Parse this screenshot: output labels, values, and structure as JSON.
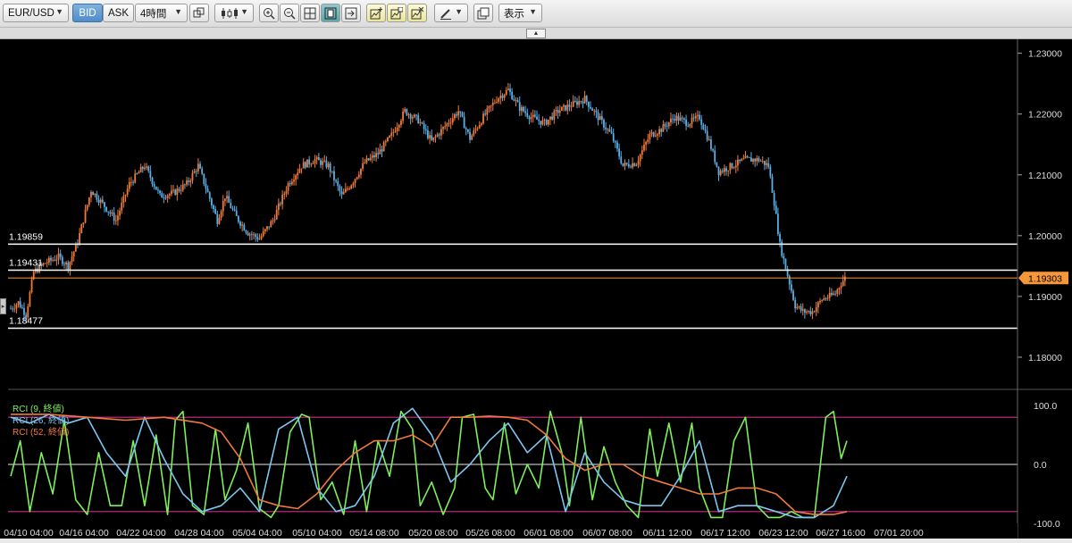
{
  "toolbar": {
    "symbol": "EUR/USD",
    "bid_label": "BID",
    "ask_label": "ASK",
    "timeframe": "4時間",
    "view_label": "表示",
    "caret": "▼"
  },
  "colors": {
    "background": "#000000",
    "bull_candle": "#f07a3a",
    "bear_candle": "#5aaee6",
    "price_line": "#f5973a",
    "horizontal_line": "#ffffff",
    "rci9": "#7df05a",
    "rci26": "#7cc6f0",
    "rci52": "#f07a3a",
    "rci_band": "#c8308c"
  },
  "chart_data": [
    {
      "type": "candlestick",
      "instrument": "EUR/USD",
      "timeframe": "4時間",
      "ylim": [
        1.175,
        1.232
      ],
      "y_ticks": [
        "1.23000",
        "1.22000",
        "1.21000",
        "1.20000",
        "1.19000",
        "1.18000"
      ],
      "x_ticks": [
        "04/10 04:00",
        "04/16 04:00",
        "04/22 04:00",
        "04/28 04:00",
        "05/04 04:00",
        "05/10 04:00",
        "05/14 08:00",
        "05/20 08:00",
        "05/26 08:00",
        "06/01 08:00",
        "06/07 08:00",
        "06/11 12:00",
        "06/17 12:00",
        "06/23 12:00",
        "06/27 16:00",
        "07/01 20:00"
      ],
      "current_price": "1.19303",
      "horizontal_lines": [
        {
          "label": "1.19859",
          "value": 1.19859
        },
        {
          "label": "1.19431",
          "value": 1.19431
        },
        {
          "label": "1.18477",
          "value": 1.18477
        }
      ],
      "price_path": [
        [
          0,
          1.188
        ],
        [
          4,
          1.189
        ],
        [
          8,
          1.187
        ],
        [
          12,
          1.194
        ],
        [
          18,
          1.1955
        ],
        [
          25,
          1.1965
        ],
        [
          30,
          1.195
        ],
        [
          35,
          1.199
        ],
        [
          42,
          1.2075
        ],
        [
          50,
          1.2045
        ],
        [
          55,
          1.2025
        ],
        [
          62,
          1.2085
        ],
        [
          70,
          1.2115
        ],
        [
          78,
          1.2065
        ],
        [
          85,
          1.207
        ],
        [
          92,
          1.2085
        ],
        [
          98,
          1.2115
        ],
        [
          103,
          1.207
        ],
        [
          108,
          1.2025
        ],
        [
          112,
          1.2065
        ],
        [
          118,
          1.203
        ],
        [
          124,
          1.2005
        ],
        [
          130,
          1.1995
        ],
        [
          137,
          1.2025
        ],
        [
          145,
          1.2085
        ],
        [
          152,
          1.2115
        ],
        [
          159,
          1.2125
        ],
        [
          166,
          1.2115
        ],
        [
          173,
          1.2065
        ],
        [
          179,
          1.209
        ],
        [
          185,
          1.212
        ],
        [
          192,
          1.2135
        ],
        [
          199,
          1.2165
        ],
        [
          206,
          1.2205
        ],
        [
          213,
          1.219
        ],
        [
          220,
          1.2155
        ],
        [
          227,
          1.218
        ],
        [
          234,
          1.2205
        ],
        [
          240,
          1.216
        ],
        [
          247,
          1.2195
        ],
        [
          254,
          1.2225
        ],
        [
          260,
          1.224
        ],
        [
          266,
          1.221
        ],
        [
          272,
          1.2195
        ],
        [
          279,
          1.2185
        ],
        [
          286,
          1.2205
        ],
        [
          293,
          1.2215
        ],
        [
          300,
          1.2225
        ],
        [
          307,
          1.2195
        ],
        [
          314,
          1.2165
        ],
        [
          320,
          1.2115
        ],
        [
          327,
          1.212
        ],
        [
          334,
          1.2165
        ],
        [
          340,
          1.2175
        ],
        [
          347,
          1.2195
        ],
        [
          354,
          1.2185
        ],
        [
          360,
          1.2195
        ],
        [
          365,
          1.2155
        ],
        [
          370,
          1.2105
        ],
        [
          377,
          1.2115
        ],
        [
          384,
          1.2125
        ],
        [
          391,
          1.2125
        ],
        [
          396,
          1.2115
        ],
        [
          399,
          1.2055
        ],
        [
          402,
          1.1985
        ],
        [
          406,
          1.1935
        ],
        [
          410,
          1.1885
        ],
        [
          414,
          1.1875
        ],
        [
          419,
          1.1875
        ],
        [
          424,
          1.1895
        ],
        [
          428,
          1.19
        ],
        [
          431,
          1.1905
        ],
        [
          434,
          1.1922
        ],
        [
          436,
          1.19303
        ]
      ]
    },
    {
      "type": "line",
      "title": "RCI",
      "ylim": [
        -100,
        100
      ],
      "y_ticks": [
        "100.0",
        "0.0",
        "-100.0"
      ],
      "bands": [
        80,
        0,
        -80
      ],
      "series": [
        {
          "name": "RCI (9, 終値)",
          "points": [
            [
              0,
              -20
            ],
            [
              5,
              40
            ],
            [
              10,
              -80
            ],
            [
              16,
              20
            ],
            [
              22,
              -50
            ],
            [
              28,
              75
            ],
            [
              34,
              -60
            ],
            [
              40,
              -85
            ],
            [
              46,
              20
            ],
            [
              52,
              -70
            ],
            [
              58,
              -70
            ],
            [
              64,
              40
            ],
            [
              70,
              -70
            ],
            [
              76,
              50
            ],
            [
              82,
              -85
            ],
            [
              86,
              75
            ],
            [
              90,
              90
            ],
            [
              95,
              -70
            ],
            [
              101,
              -85
            ],
            [
              107,
              60
            ],
            [
              112,
              -60
            ],
            [
              118,
              -10
            ],
            [
              124,
              70
            ],
            [
              130,
              -75
            ],
            [
              136,
              -90
            ],
            [
              140,
              -70
            ],
            [
              146,
              55
            ],
            [
              152,
              85
            ],
            [
              156,
              80
            ],
            [
              162,
              -60
            ],
            [
              168,
              -30
            ],
            [
              174,
              -85
            ],
            [
              180,
              40
            ],
            [
              186,
              -80
            ],
            [
              192,
              40
            ],
            [
              198,
              -20
            ],
            [
              204,
              90
            ],
            [
              210,
              60
            ],
            [
              214,
              -70
            ],
            [
              220,
              -30
            ],
            [
              226,
              -85
            ],
            [
              232,
              -40
            ],
            [
              236,
              80
            ],
            [
              242,
              85
            ],
            [
              248,
              -40
            ],
            [
              252,
              -60
            ],
            [
              258,
              70
            ],
            [
              264,
              -50
            ],
            [
              270,
              0
            ],
            [
              276,
              -40
            ],
            [
              282,
              90
            ],
            [
              288,
              20
            ],
            [
              292,
              -70
            ],
            [
              298,
              80
            ],
            [
              304,
              -60
            ],
            [
              310,
              30
            ],
            [
              316,
              -30
            ],
            [
              322,
              -70
            ],
            [
              328,
              -90
            ],
            [
              334,
              60
            ],
            [
              338,
              -20
            ],
            [
              344,
              70
            ],
            [
              350,
              -30
            ],
            [
              356,
              70
            ],
            [
              360,
              -40
            ],
            [
              366,
              -90
            ],
            [
              372,
              -90
            ],
            [
              378,
              40
            ],
            [
              384,
              80
            ],
            [
              390,
              -70
            ],
            [
              396,
              -90
            ],
            [
              402,
              -90
            ],
            [
              408,
              -80
            ],
            [
              414,
              -90
            ],
            [
              420,
              -90
            ],
            [
              426,
              80
            ],
            [
              430,
              90
            ],
            [
              434,
              10
            ],
            [
              437,
              40
            ]
          ]
        },
        {
          "name": "RCI (26, 終値)",
          "points": [
            [
              0,
              80
            ],
            [
              10,
              70
            ],
            [
              20,
              85
            ],
            [
              30,
              70
            ],
            [
              40,
              80
            ],
            [
              50,
              20
            ],
            [
              60,
              -20
            ],
            [
              70,
              80
            ],
            [
              80,
              10
            ],
            [
              90,
              -50
            ],
            [
              100,
              -80
            ],
            [
              110,
              -70
            ],
            [
              120,
              -40
            ],
            [
              130,
              -80
            ],
            [
              140,
              60
            ],
            [
              150,
              80
            ],
            [
              160,
              -40
            ],
            [
              170,
              -80
            ],
            [
              180,
              -70
            ],
            [
              190,
              -20
            ],
            [
              200,
              70
            ],
            [
              210,
              95
            ],
            [
              220,
              50
            ],
            [
              230,
              -30
            ],
            [
              240,
              0
            ],
            [
              250,
              40
            ],
            [
              260,
              70
            ],
            [
              270,
              20
            ],
            [
              280,
              50
            ],
            [
              290,
              -80
            ],
            [
              300,
              20
            ],
            [
              310,
              -30
            ],
            [
              320,
              -60
            ],
            [
              330,
              -70
            ],
            [
              340,
              -70
            ],
            [
              350,
              -20
            ],
            [
              360,
              40
            ],
            [
              370,
              -80
            ],
            [
              380,
              -70
            ],
            [
              390,
              -70
            ],
            [
              400,
              -80
            ],
            [
              410,
              -90
            ],
            [
              420,
              -90
            ],
            [
              430,
              -70
            ],
            [
              437,
              -20
            ]
          ]
        },
        {
          "name": "RCI (52, 終値)",
          "points": [
            [
              0,
              85
            ],
            [
              20,
              85
            ],
            [
              40,
              80
            ],
            [
              60,
              75
            ],
            [
              80,
              80
            ],
            [
              100,
              70
            ],
            [
              110,
              55
            ],
            [
              120,
              10
            ],
            [
              130,
              -60
            ],
            [
              140,
              -70
            ],
            [
              150,
              -75
            ],
            [
              160,
              -50
            ],
            [
              170,
              -10
            ],
            [
              180,
              20
            ],
            [
              190,
              40
            ],
            [
              200,
              40
            ],
            [
              210,
              50
            ],
            [
              220,
              30
            ],
            [
              230,
              80
            ],
            [
              240,
              80
            ],
            [
              250,
              82
            ],
            [
              260,
              80
            ],
            [
              270,
              75
            ],
            [
              280,
              50
            ],
            [
              290,
              10
            ],
            [
              300,
              -10
            ],
            [
              310,
              0
            ],
            [
              320,
              0
            ],
            [
              330,
              -20
            ],
            [
              340,
              -30
            ],
            [
              350,
              -40
            ],
            [
              360,
              -50
            ],
            [
              370,
              -50
            ],
            [
              380,
              -40
            ],
            [
              390,
              -40
            ],
            [
              400,
              -50
            ],
            [
              410,
              -80
            ],
            [
              420,
              -85
            ],
            [
              430,
              -85
            ],
            [
              437,
              -80
            ]
          ]
        }
      ]
    }
  ]
}
